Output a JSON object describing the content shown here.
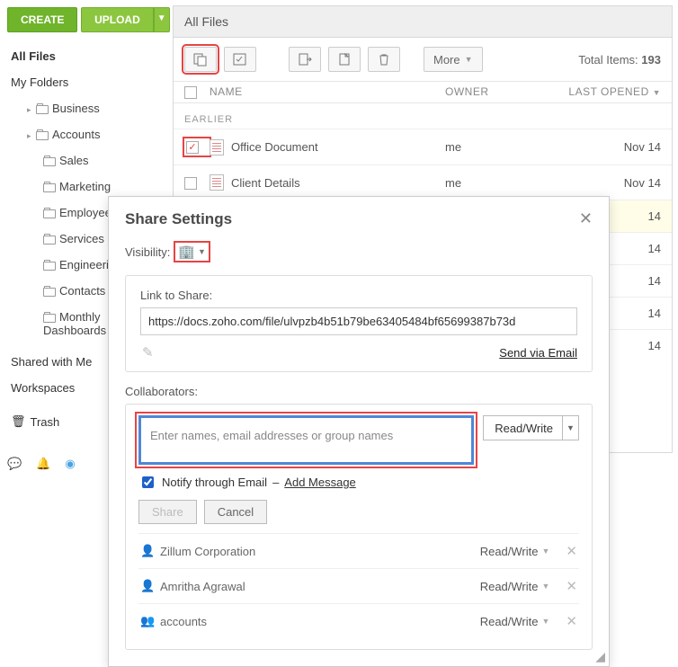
{
  "topbar": {
    "create": "CREATE",
    "upload": "UPLOAD"
  },
  "sidebar": {
    "all_files": "All Files",
    "my_folders": "My Folders",
    "folders": [
      {
        "label": "Business",
        "expand": true
      },
      {
        "label": "Accounts",
        "expand": true
      }
    ],
    "subfolders": [
      "Sales",
      "Marketing",
      "Employees",
      "Services",
      "Engineering",
      "Contacts",
      "Monthly Dashboards"
    ],
    "shared": "Shared with Me",
    "workspaces": "Workspaces",
    "trash": "Trash"
  },
  "panel": {
    "title": "All Files",
    "total_label": "Total Items:",
    "total": "193",
    "more": "More",
    "columns": {
      "name": "NAME",
      "owner": "OWNER",
      "date": "LAST OPENED"
    },
    "group": "EARLIER",
    "rows": [
      {
        "name": "Office Document",
        "owner": "me",
        "date": "Nov 14",
        "checked": true,
        "hl": false
      },
      {
        "name": "Client Details",
        "owner": "me",
        "date": "Nov 14",
        "checked": false,
        "hl": false
      },
      {
        "name": "",
        "owner": "",
        "date": "14",
        "hl": true
      },
      {
        "name": "",
        "owner": "",
        "date": "14"
      },
      {
        "name": "",
        "owner": "",
        "date": "14"
      },
      {
        "name": "",
        "owner": "",
        "date": "14"
      },
      {
        "name": "",
        "owner": "",
        "date": "14"
      }
    ]
  },
  "modal": {
    "title": "Share Settings",
    "visibility_label": "Visibility:",
    "link_label": "Link to Share:",
    "link_url": "https://docs.zoho.com/file/ulvpzb4b51b79be63405484bf65699387b73d",
    "send_via_email": "Send via Email",
    "collaborators_label": "Collaborators:",
    "input_placeholder": "Enter names, email addresses or group names",
    "permission": "Read/Write",
    "notify_label": "Notify through Email",
    "add_message": "Add Message",
    "share_btn": "Share",
    "cancel_btn": "Cancel",
    "people": [
      {
        "icon": "person",
        "name": "Zillum Corporation",
        "perm": "Read/Write"
      },
      {
        "icon": "person",
        "name": "Amritha Agrawal",
        "perm": "Read/Write"
      },
      {
        "icon": "group",
        "name": "accounts",
        "perm": "Read/Write"
      }
    ]
  }
}
